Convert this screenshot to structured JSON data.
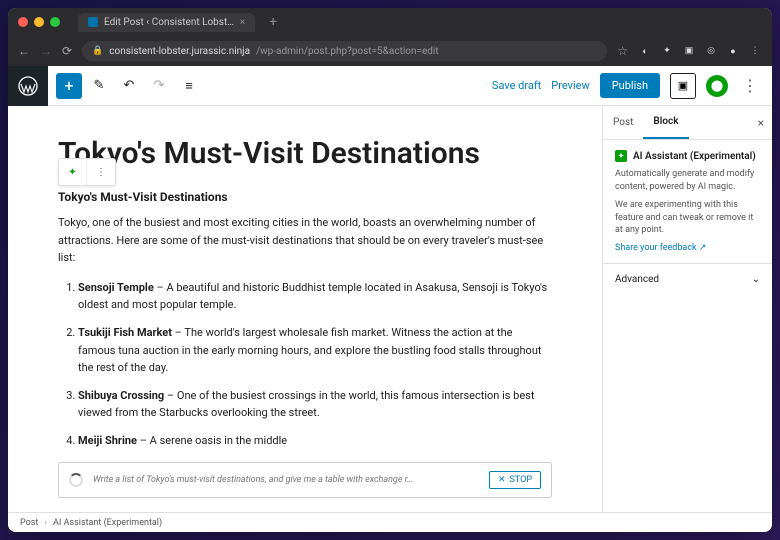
{
  "browser": {
    "tab_title": "Edit Post ‹ Consistent Lobst…",
    "url_domain": "consistent-lobster.jurassic.ninja",
    "url_path": "/wp-admin/post.php?post=5&action=edit",
    "star": "☆"
  },
  "toolbar": {
    "save_draft": "Save draft",
    "preview": "Preview",
    "publish": "Publish"
  },
  "post": {
    "title": "Tokyo's Must-Visit Destinations",
    "subheading": "Tokyo's Must-Visit Destinations",
    "intro": "Tokyo, one of the busiest and most exciting cities in the world, boasts an overwhelming number of attractions. Here are some of the must-visit destinations that should be on every traveler's must-see list:",
    "items": [
      {
        "name": "Sensoji Temple",
        "desc": " – A beautiful and historic Buddhist temple located in Asakusa, Sensoji is Tokyo's oldest and most popular temple."
      },
      {
        "name": "Tsukiji Fish Market",
        "desc": " – The world's largest wholesale fish market. Witness the action at the famous tuna auction in the early morning hours, and explore the bustling food stalls throughout the rest of the day."
      },
      {
        "name": "Shibuya Crossing",
        "desc": " – One of the busiest crossings in the world, this famous intersection is best viewed from the Starbucks overlooking the street."
      },
      {
        "name": "Meiji Shrine",
        "desc": " – A serene oasis in the middle"
      }
    ],
    "ai_placeholder": "Write a list of Tokyo's must-visit destinations, and give me a table with exchange r…",
    "stop_label": "STOP"
  },
  "sidebar": {
    "tab_post": "Post",
    "tab_block": "Block",
    "ai_title": "AI Assistant (Experimental)",
    "ai_desc": "Automatically generate and modify content, powered by AI magic.",
    "ai_note": "We are experimenting with this feature and can tweak or remove it at any point.",
    "ai_link": "Share your feedback ↗",
    "advanced": "Advanced"
  },
  "footer": {
    "crumb1": "Post",
    "crumb2": "AI Assistant (Experimental)"
  }
}
